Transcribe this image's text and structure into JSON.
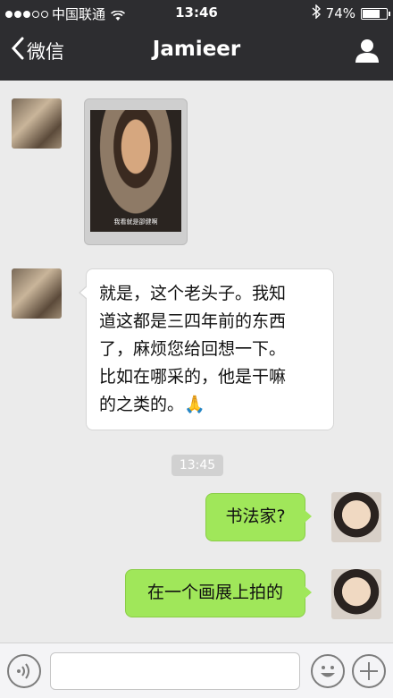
{
  "status_bar": {
    "carrier": "中国联通",
    "time": "13:46",
    "battery": "74%",
    "battery_level": 0.74,
    "signal_bars_filled": 3,
    "signal_bars_total": 5
  },
  "nav": {
    "back_label": "微信",
    "title": "Jamieer",
    "back_icon": "chevron-left-icon",
    "profile_icon": "person-icon"
  },
  "messages": [
    {
      "sender": "other",
      "type": "image",
      "image_caption": "我看就是邵健啊"
    },
    {
      "sender": "other",
      "type": "text",
      "lines": [
        "就是，这个老头子。我知",
        "道这都是三四年前的东西",
        "了，麻烦您给回想一下。",
        "比如在哪采的，他是干嘛",
        "的之类的。🙏"
      ]
    },
    {
      "sender": "system",
      "type": "time",
      "text": "13:45"
    },
    {
      "sender": "me",
      "type": "text",
      "text": "书法家?"
    },
    {
      "sender": "me",
      "type": "text",
      "text": "在一个画展上拍的"
    }
  ],
  "input_bar": {
    "voice_icon": "voice-icon",
    "message_value": "",
    "emoji_icon": "emoji-icon",
    "plus_icon": "plus-icon"
  },
  "colors": {
    "nav_bg": "#2d2d30",
    "chat_bg": "#ebebeb",
    "my_bubble": "#a0e75a",
    "their_bubble": "#ffffff",
    "timestamp_bg": "#d1d1d1"
  }
}
